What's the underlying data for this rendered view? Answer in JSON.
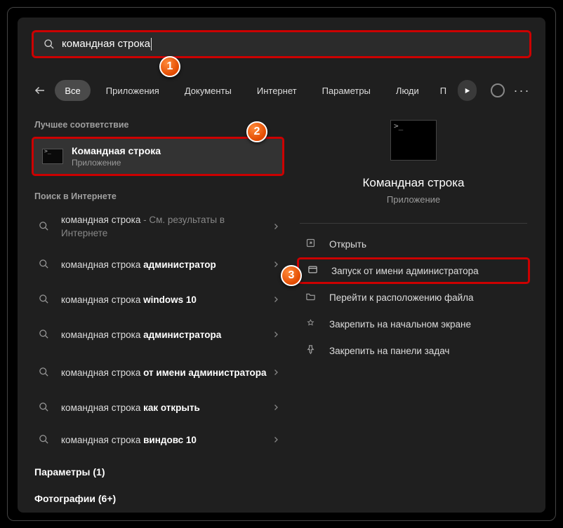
{
  "search": {
    "query": "командная строка"
  },
  "filters": {
    "all": "Все",
    "apps": "Приложения",
    "docs": "Документы",
    "web": "Интернет",
    "settings": "Параметры",
    "people": "Люди",
    "more_initial": "П"
  },
  "sections": {
    "best": "Лучшее соответствие",
    "web": "Поиск в Интернете",
    "settings_cat": "Параметры (1)",
    "photos_cat": "Фотографии (6+)"
  },
  "best_match": {
    "title": "Командная строка",
    "subtitle": "Приложение"
  },
  "web_results": [
    {
      "prefix": "командная строка",
      "suffix": " - См. результаты в Интернете",
      "bold": ""
    },
    {
      "prefix": "командная строка ",
      "bold": "администратор",
      "suffix": ""
    },
    {
      "prefix": "командная строка ",
      "bold": "windows 10",
      "suffix": ""
    },
    {
      "prefix": "командная строка ",
      "bold": "администратора",
      "suffix": ""
    },
    {
      "prefix": "командная строка ",
      "bold": "от имени администратора",
      "suffix": ""
    },
    {
      "prefix": "командная строка ",
      "bold": "как открыть",
      "suffix": ""
    },
    {
      "prefix": "командная строка ",
      "bold": "виндовс 10",
      "suffix": ""
    }
  ],
  "preview": {
    "title": "Командная строка",
    "subtitle": "Приложение",
    "actions": {
      "open": "Открыть",
      "run_admin": "Запуск от имени администратора",
      "file_location": "Перейти к расположению файла",
      "pin_start": "Закрепить на начальном экране",
      "pin_taskbar": "Закрепить на панели задач"
    }
  },
  "annotations": {
    "b1": "1",
    "b2": "2",
    "b3": "3"
  }
}
